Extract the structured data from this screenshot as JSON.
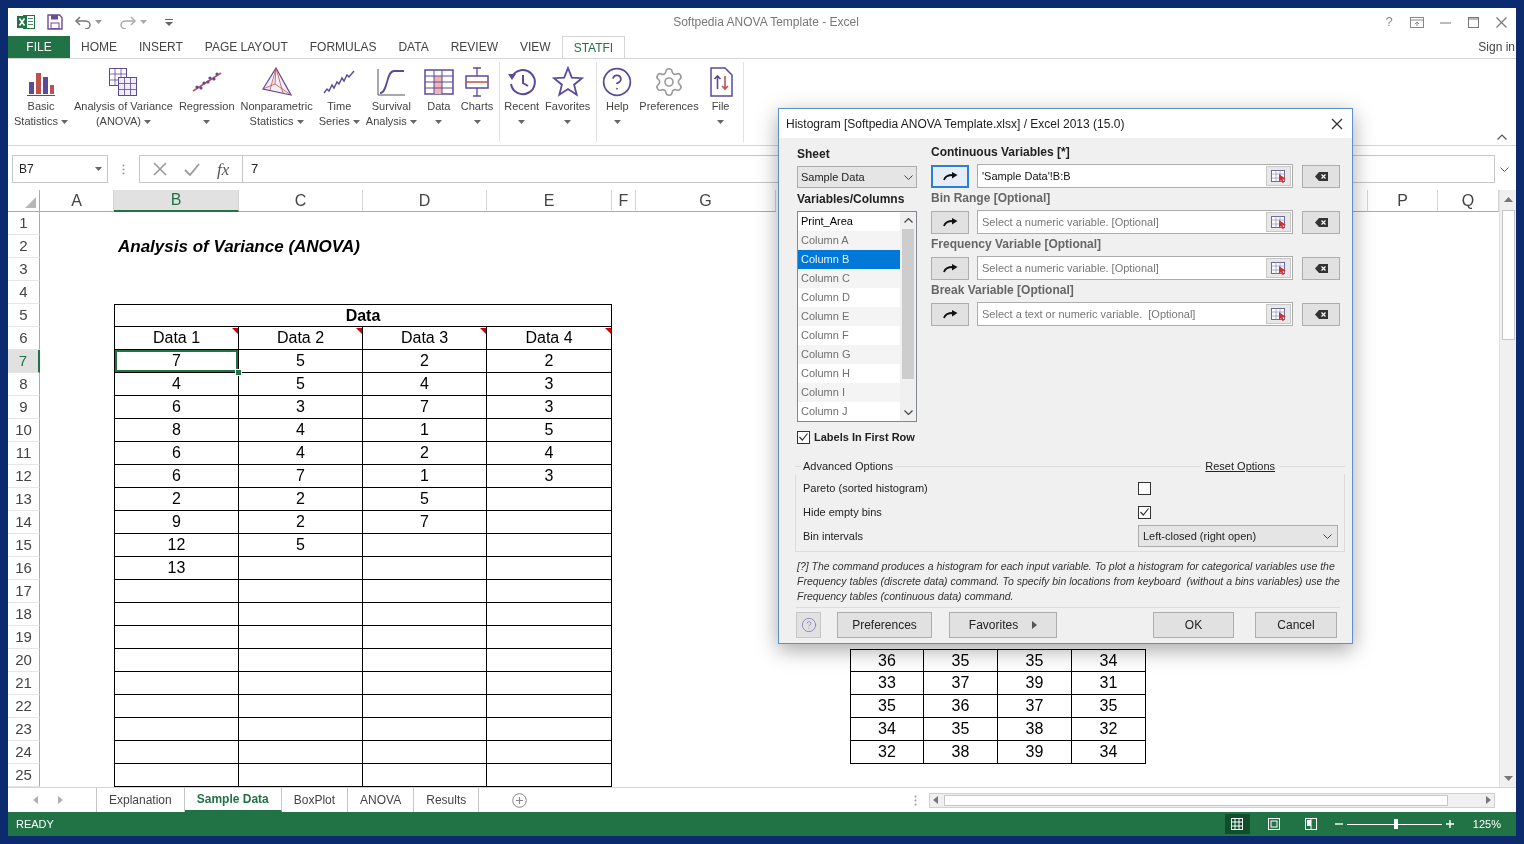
{
  "title_bar": {
    "title": "Softpedia ANOVA Template - Excel",
    "help": "?"
  },
  "ribbon_tabs": [
    {
      "label": "FILE",
      "kind": "file",
      "selected": false
    },
    {
      "label": "HOME",
      "kind": "tab",
      "selected": false
    },
    {
      "label": "INSERT",
      "kind": "tab",
      "selected": false
    },
    {
      "label": "PAGE LAYOUT",
      "kind": "tab",
      "selected": false
    },
    {
      "label": "FORMULAS",
      "kind": "tab",
      "selected": false
    },
    {
      "label": "DATA",
      "kind": "tab",
      "selected": false
    },
    {
      "label": "REVIEW",
      "kind": "tab",
      "selected": false
    },
    {
      "label": "VIEW",
      "kind": "tab",
      "selected": false
    },
    {
      "label": "STATFI",
      "kind": "tab",
      "selected": true
    }
  ],
  "account": "Sign in",
  "ribbon": {
    "groups": [
      {
        "buttons": [
          {
            "label_lines": [
              "Basic",
              "Statistics"
            ],
            "dropdown": true
          },
          {
            "label_lines": [
              "Analysis of Variance",
              "(ANOVA)"
            ],
            "dropdown": true
          },
          {
            "label_lines": [
              "Regression"
            ],
            "dropdown": true
          },
          {
            "label_lines": [
              "Nonparametric",
              "Statistics"
            ],
            "dropdown": true
          },
          {
            "label_lines": [
              "Time",
              "Series"
            ],
            "dropdown": true
          },
          {
            "label_lines": [
              "Survival",
              "Analysis"
            ],
            "dropdown": true
          },
          {
            "label_lines": [
              "Data"
            ],
            "dropdown": true
          },
          {
            "label_lines": [
              "Charts"
            ],
            "dropdown": true
          }
        ]
      },
      {
        "buttons": [
          {
            "label_lines": [
              "Recent"
            ],
            "dropdown": true
          },
          {
            "label_lines": [
              "Favorites"
            ],
            "dropdown": true
          }
        ]
      },
      {
        "buttons": [
          {
            "label_lines": [
              "Help"
            ],
            "dropdown": true
          },
          {
            "label_lines": [
              "Preferences"
            ],
            "dropdown": false
          },
          {
            "label_lines": [
              "File"
            ],
            "dropdown": true
          }
        ]
      }
    ]
  },
  "formula_bar": {
    "name_box": "B7",
    "function_button": "fx",
    "formula": "7"
  },
  "sheet": {
    "columns": [
      {
        "label": "A",
        "selected": false
      },
      {
        "label": "B",
        "selected": true
      },
      {
        "label": "C",
        "selected": false
      },
      {
        "label": "D",
        "selected": false
      },
      {
        "label": "E",
        "selected": false
      },
      {
        "label": "F",
        "selected": false
      },
      {
        "label": "G",
        "selected": false
      },
      {
        "label": "P",
        "selected": false
      },
      {
        "label": "Q",
        "selected": false
      }
    ],
    "rows": [
      {
        "label": "1",
        "selected": false
      },
      {
        "label": "2",
        "selected": false
      },
      {
        "label": "3",
        "selected": false
      },
      {
        "label": "4",
        "selected": false
      },
      {
        "label": "5",
        "selected": false
      },
      {
        "label": "6",
        "selected": false
      },
      {
        "label": "7",
        "selected": true
      },
      {
        "label": "8",
        "selected": false
      },
      {
        "label": "9",
        "selected": false
      },
      {
        "label": "10",
        "selected": false
      },
      {
        "label": "11",
        "selected": false
      },
      {
        "label": "12",
        "selected": false
      },
      {
        "label": "13",
        "selected": false
      },
      {
        "label": "14",
        "selected": false
      },
      {
        "label": "15",
        "selected": false
      },
      {
        "label": "16",
        "selected": false
      },
      {
        "label": "17",
        "selected": false
      },
      {
        "label": "18",
        "selected": false
      },
      {
        "label": "19",
        "selected": false
      },
      {
        "label": "20",
        "selected": false
      },
      {
        "label": "21",
        "selected": false
      },
      {
        "label": "22",
        "selected": false
      },
      {
        "label": "23",
        "selected": false
      },
      {
        "label": "24",
        "selected": false
      },
      {
        "label": "25",
        "selected": false
      }
    ],
    "title": "Analysis of Variance (ANOVA)",
    "table": {
      "title": "Data",
      "headers": [
        {
          "label": "Data 1",
          "has_comment": true
        },
        {
          "label": "Data 2",
          "has_comment": true
        },
        {
          "label": "Data 3",
          "has_comment": true
        },
        {
          "label": "Data 4",
          "has_comment": true
        }
      ],
      "rows": [
        [
          "7",
          "5",
          "2",
          "2"
        ],
        [
          "4",
          "5",
          "4",
          "3"
        ],
        [
          "6",
          "3",
          "7",
          "3"
        ],
        [
          "8",
          "4",
          "1",
          "5"
        ],
        [
          "6",
          "4",
          "2",
          "4"
        ],
        [
          "6",
          "7",
          "1",
          "3"
        ],
        [
          "2",
          "2",
          "5"
        ],
        [
          "9",
          "2",
          "7"
        ],
        [
          "12",
          "5"
        ],
        [
          "13"
        ]
      ]
    },
    "second_table": {
      "rows": [
        [
          "36",
          "35",
          "35",
          "34"
        ],
        [
          "33",
          "37",
          "39",
          "31"
        ],
        [
          "35",
          "36",
          "37",
          "35"
        ],
        [
          "34",
          "35",
          "38",
          "32"
        ],
        [
          "32",
          "38",
          "39",
          "34"
        ]
      ]
    }
  },
  "sheet_tabs": [
    {
      "label": "Explanation",
      "selected": false
    },
    {
      "label": "Sample Data",
      "selected": true
    },
    {
      "label": "BoxPlot",
      "selected": false
    },
    {
      "label": "ANOVA",
      "selected": false
    },
    {
      "label": "Results",
      "selected": false
    }
  ],
  "status_bar": {
    "status": "READY",
    "views": [
      {
        "selected": true
      },
      {
        "selected": false
      },
      {
        "selected": false
      }
    ],
    "zoom_slider": {
      "level": 0.52
    },
    "zoom": "125%"
  },
  "dialog": {
    "title": "Histogram [Softpedia ANOVA Template.xlsx] / Excel 2013 (15.0)",
    "sheet": {
      "label": "Sheet",
      "value": "Sample Data"
    },
    "variables_label": "Variables/Columns",
    "variables": [
      {
        "label": "Print_Area",
        "dimmed": false,
        "selected": false
      },
      {
        "label": "Column A",
        "dimmed": true,
        "selected": false
      },
      {
        "label": "Column B",
        "dimmed": true,
        "selected": true
      },
      {
        "label": "Column C",
        "dimmed": true,
        "selected": false
      },
      {
        "label": "Column D",
        "dimmed": true,
        "selected": false
      },
      {
        "label": "Column E",
        "dimmed": true,
        "selected": false
      },
      {
        "label": "Column F",
        "dimmed": true,
        "selected": false
      },
      {
        "label": "Column G",
        "dimmed": true,
        "selected": false
      },
      {
        "label": "Column H",
        "dimmed": true,
        "selected": false
      },
      {
        "label": "Column I",
        "dimmed": true,
        "selected": false
      },
      {
        "label": "Column J",
        "dimmed": true,
        "selected": false
      }
    ],
    "labels_in_first_row": {
      "label": "Labels In First Row",
      "checked": true
    },
    "fields": [
      {
        "label": "Continuous Variables [*]",
        "required": true,
        "focused": true,
        "value": "'Sample Data'!B:B"
      },
      {
        "label": "Bin Range [Optional]",
        "required": false,
        "focused": false,
        "placeholder": "Select a numeric variable. [Optional]"
      },
      {
        "label": "Frequency Variable [Optional]",
        "required": false,
        "focused": false,
        "placeholder": "Select a numeric variable. [Optional]"
      },
      {
        "label": "Break Variable [Optional]",
        "required": false,
        "focused": false,
        "placeholder": "Select a text or numeric variable.  [Optional]"
      }
    ],
    "advanced": {
      "title": "Advanced Options",
      "reset": "Reset Options",
      "options": [
        {
          "kind": "checkbox",
          "label": "Pareto (sorted histogram)",
          "checked": false
        },
        {
          "kind": "checkbox",
          "label": "Hide empty bins",
          "checked": true
        },
        {
          "kind": "select",
          "label": "Bin intervals",
          "value": "Left-closed (right open)"
        }
      ]
    },
    "note": "[?] The command produces a histogram for each input variable. To plot a histogram for categorical variables use the Frequency tables (discrete data) command. To specify bin locations from keyboard  (without a bins variables) use the Frequency tables (continuous data) command.",
    "buttons": [
      {
        "label": "Preferences",
        "kind": "plain"
      },
      {
        "label": "Favorites",
        "kind": "submenu"
      },
      {
        "label": "OK",
        "kind": "plain"
      },
      {
        "label": "Cancel",
        "kind": "plain"
      }
    ]
  }
}
